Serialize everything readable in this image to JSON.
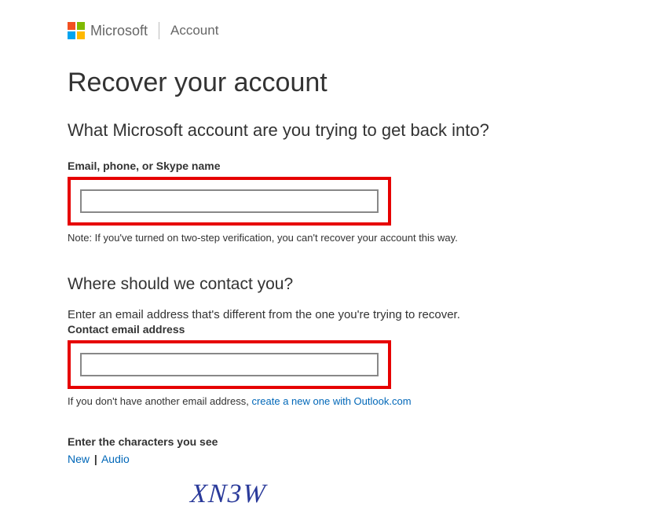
{
  "header": {
    "brand": "Microsoft",
    "section": "Account"
  },
  "page": {
    "title": "Recover your account",
    "question1": "What Microsoft account are you trying to get back into?",
    "identifier_label": "Email, phone, or Skype name",
    "identifier_value": "",
    "twostep_note": "Note: If you've turned on two-step verification, you can't recover your account this way.",
    "question2": "Where should we contact you?",
    "contact_instruction": "Enter an email address that's different from the one you're trying to recover.",
    "contact_label": "Contact email address",
    "contact_value": "",
    "no_email_prefix": "If you don't have another email address, ",
    "no_email_link": "create a new one with Outlook.com",
    "captcha_label": "Enter the characters you see",
    "captcha_new": "New",
    "captcha_sep": "|",
    "captcha_audio": "Audio",
    "captcha_text": "XN3W"
  }
}
